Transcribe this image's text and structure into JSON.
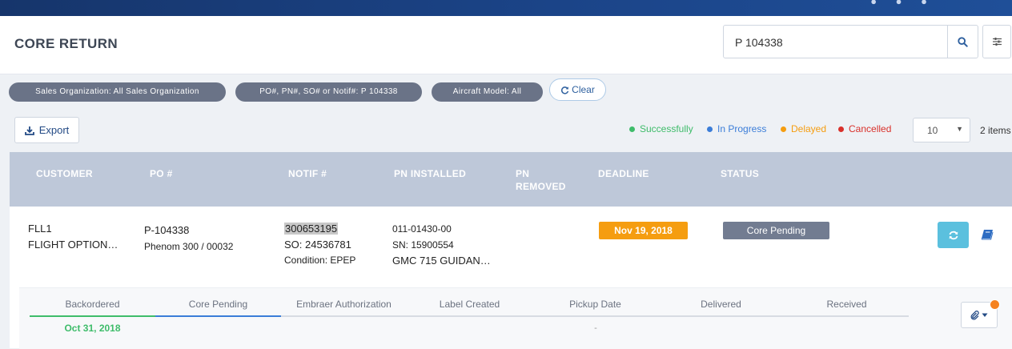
{
  "header": {
    "title": "CORE RETURN",
    "search": {
      "value": "P 104338"
    }
  },
  "filters": {
    "chips": [
      "Sales Organization: All Sales Organization",
      "PO#, PN#, SO# or Notif#: P 104338",
      "Aircraft Model: All"
    ],
    "clear_label": "Clear"
  },
  "toolbar": {
    "export_label": "Export",
    "legend": [
      {
        "label": "Successfully",
        "color": "#3ebc6a"
      },
      {
        "label": "In Progress",
        "color": "#3b7dd8"
      },
      {
        "label": "Delayed",
        "color": "#f59d10"
      },
      {
        "label": "Cancelled",
        "color": "#d9312b"
      }
    ],
    "page_size": "10",
    "items_count": "2 items"
  },
  "table": {
    "columns": [
      "CUSTOMER",
      "PO #",
      "NOTIF #",
      "PN INSTALLED",
      "PN REMOVED",
      "DEADLINE",
      "STATUS"
    ],
    "rows": [
      {
        "customer_code": "FLL1",
        "customer_name": "FLIGHT OPTION…",
        "po": "P-104338",
        "aircraft": "Phenom 300 / 00032",
        "notif": "300653195",
        "so": "SO: 24536781",
        "condition": "Condition: EPEP",
        "pn_installed": "011-01430-00",
        "serial": "SN: 15900554",
        "pn_description": "GMC 715 GUIDAN…",
        "deadline": "Nov 19, 2018",
        "status": "Core Pending"
      }
    ]
  },
  "tracker": {
    "steps": [
      "Backordered",
      "Core Pending",
      "Embraer Authorization",
      "Label Created",
      "Pickup Date",
      "Delivered",
      "Received"
    ],
    "backordered_date": "Oct 31, 2018",
    "pickup_value": "-"
  },
  "colors": {
    "brand": "#1b4488",
    "deadline": "#f59d10",
    "status": "#727c91",
    "action": "#5bc0de"
  }
}
